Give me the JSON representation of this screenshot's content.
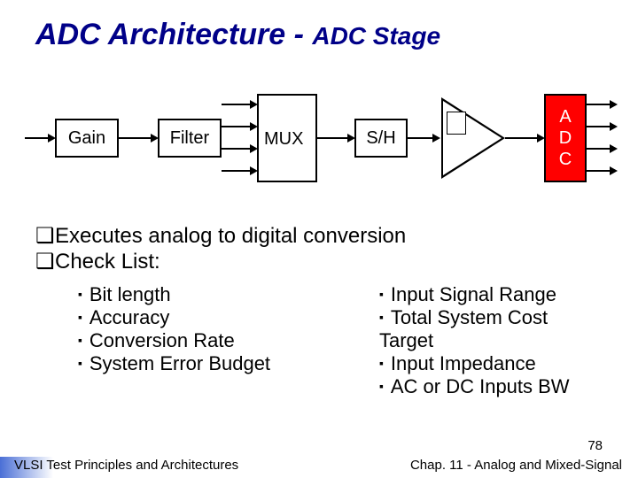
{
  "title": {
    "big": "ADC Architecture - ",
    "small": "ADC Stage"
  },
  "blocks": {
    "gain": "Gain",
    "filter": "Filter",
    "mux": "MUX",
    "sh": "S/H",
    "adc": {
      "l1": "A",
      "l2": "D",
      "l3": "C"
    }
  },
  "bullets": {
    "exec": "Executes analog to digital conversion",
    "check": "Check List:"
  },
  "col1": [
    "Bit length",
    "Accuracy",
    "Conversion Rate",
    "System Error Budget"
  ],
  "col2": [
    "Input Signal Range",
    "Total System Cost Target",
    "Input Impedance",
    "AC or DC Inputs BW"
  ],
  "footer": {
    "left": "VLSI Test Principles and Architectures",
    "right": "Chap. 11 - Analog and Mixed-Signal",
    "page": "78"
  }
}
